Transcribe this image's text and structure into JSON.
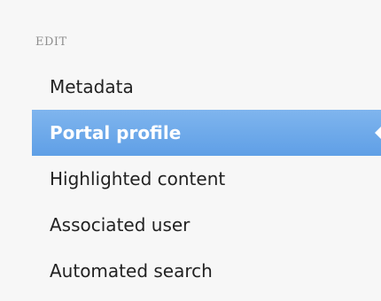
{
  "section": {
    "title": "EDIT"
  },
  "menu": {
    "items": [
      {
        "label": "Metadata",
        "active": false
      },
      {
        "label": "Portal profile",
        "active": true
      },
      {
        "label": "Highlighted content",
        "active": false
      },
      {
        "label": "Associated user",
        "active": false
      },
      {
        "label": "Automated search",
        "active": false
      }
    ]
  },
  "colors": {
    "active_background": "#6aa7ea",
    "panel_background": "#f7f7f7",
    "section_title": "#8e8e8e",
    "text": "#222222"
  }
}
